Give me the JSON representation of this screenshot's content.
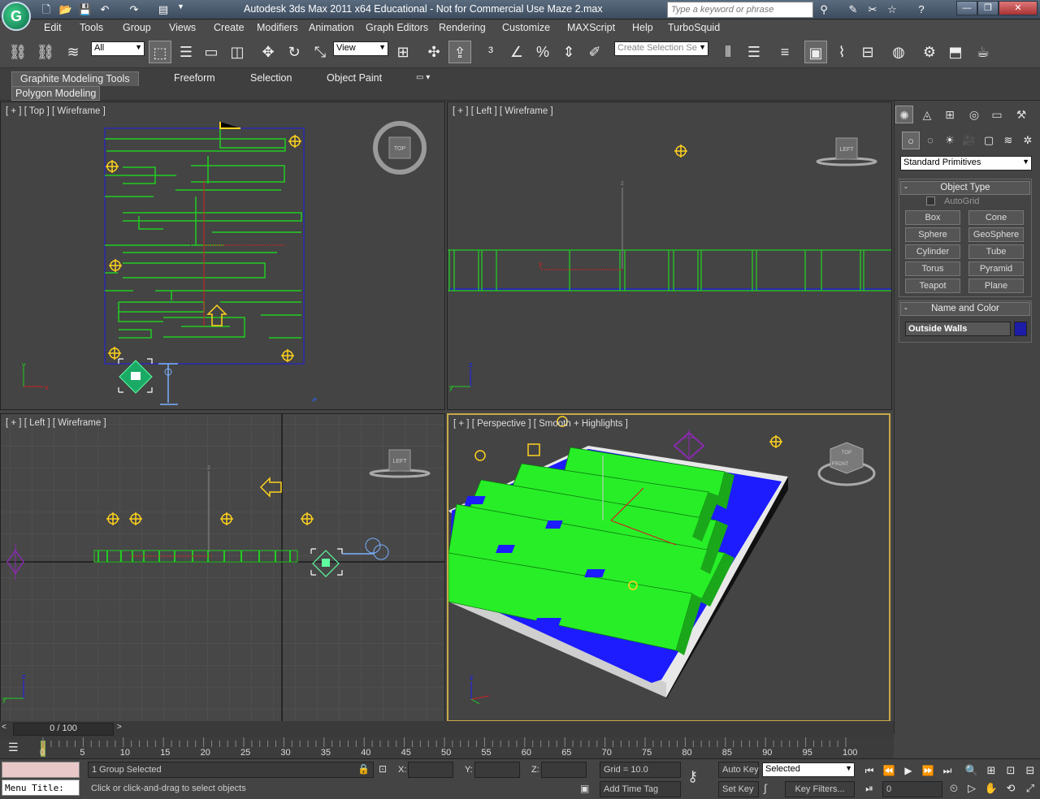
{
  "app": {
    "title": "Autodesk 3ds Max  2011 x64   Educational - Not for Commercial Use    Maze 2.max",
    "logo_glyph": "G",
    "search_placeholder": "Type a keyword or phrase"
  },
  "window_buttons": {
    "minimize": "—",
    "restore": "❐",
    "close": "✕"
  },
  "menu": [
    "Edit",
    "Tools",
    "Group",
    "Views",
    "Create",
    "Modifiers",
    "Animation",
    "Graph Editors",
    "Rendering",
    "Customize",
    "MAXScript",
    "Help",
    "TurboSquid"
  ],
  "toolbar": {
    "selection_filter": "All",
    "ref_coord": "View",
    "named_selection": "Create Selection Se"
  },
  "ribbon": {
    "tabs": [
      "Graphite Modeling Tools",
      "Freeform",
      "Selection",
      "Object Paint"
    ],
    "subtab": "Polygon Modeling"
  },
  "viewports": {
    "top": "[ + ] [ Top ] [ Wireframe ]",
    "left": "[ + ] [ Left ] [ Wireframe ]",
    "left2": "[ + ] [ Left ] [ Wireframe ]",
    "persp": "[ + ] [ Perspective ] [ Smooth + Highlights ]",
    "viewcube_top": "TOP",
    "viewcube_left": "LEFT",
    "viewcube_front": "FRONT"
  },
  "command_panel": {
    "category": "Standard Primitives",
    "object_type_header": "Object Type",
    "autogrid": "AutoGrid",
    "primitives": [
      "Box",
      "Cone",
      "Sphere",
      "GeoSphere",
      "Cylinder",
      "Tube",
      "Torus",
      "Pyramid",
      "Teapot",
      "Plane"
    ],
    "name_color_header": "Name and Color",
    "object_name": "Outside Walls",
    "object_color": "#1c1ca8"
  },
  "timeline": {
    "frame": "0 / 100",
    "ticks": [
      "0",
      "5",
      "10",
      "15",
      "20",
      "25",
      "30",
      "35",
      "40",
      "45",
      "50",
      "55",
      "60",
      "65",
      "70",
      "75",
      "80",
      "85",
      "90",
      "95",
      "100"
    ]
  },
  "status": {
    "selection": "1 Group Selected",
    "prompt": "Click or click-and-drag to select objects",
    "maxscript_label": "Menu Title:",
    "x_label": "X:",
    "y_label": "Y:",
    "z_label": "Z:",
    "grid": "Grid = 10.0",
    "add_time_tag": "Add Time Tag",
    "auto_key": "Auto Key",
    "set_key": "Set Key",
    "key_mode": "Selected",
    "key_filters": "Key Filters...",
    "current_frame": "0"
  },
  "colors": {
    "wall_green": "#22cc22",
    "floor_blue": "#1c1cff",
    "helper_yellow": "#ffd21e",
    "active_border": "#c8a84a"
  }
}
